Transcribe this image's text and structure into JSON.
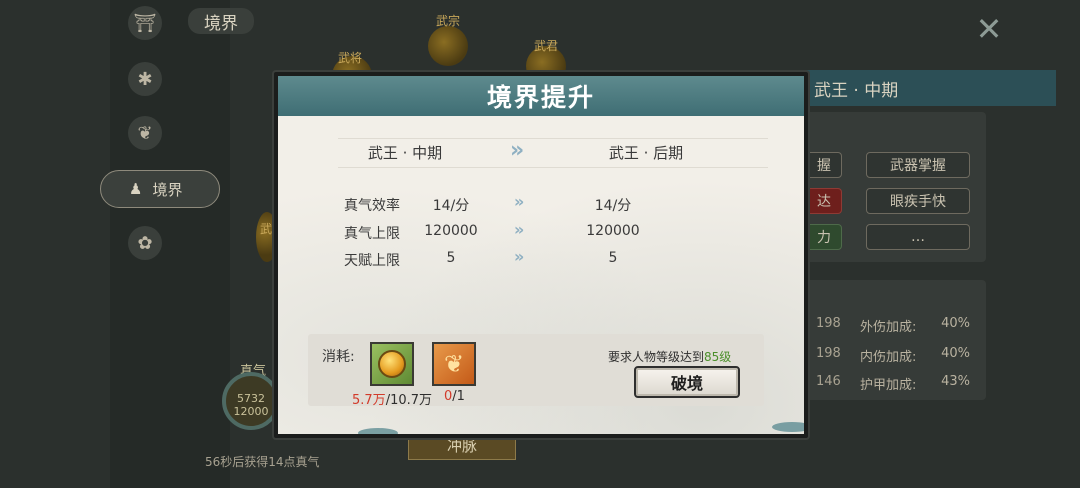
{
  "background": {
    "tab_title": "境界",
    "nav_items": [
      {
        "icon": "temple-icon",
        "glyph": "⛩"
      },
      {
        "icon": "beast-icon",
        "glyph": "✱"
      },
      {
        "icon": "flame-icon",
        "glyph": "❦"
      },
      {
        "icon": "gourd-icon",
        "glyph": "♟",
        "label": "境界",
        "active": true
      },
      {
        "icon": "creature-icon",
        "glyph": "✿"
      }
    ],
    "close_glyph": "✕",
    "right_header": "武王 · 中期",
    "right_tags": [
      "握",
      "武器掌握",
      "达",
      "眼疾手快",
      "力",
      "…"
    ],
    "right_stats": [
      {
        "num": "198",
        "label": "外伤加成:",
        "value": "40%"
      },
      {
        "num": "198",
        "label": "内伤加成:",
        "value": "40%"
      },
      {
        "num": "146",
        "label": "护甲加成:",
        "value": "43%"
      }
    ],
    "orbs": [
      {
        "label": "武将"
      },
      {
        "label": "武宗"
      },
      {
        "label": "武君"
      },
      {
        "label": "武"
      }
    ],
    "gauge_label": "真气",
    "gauge_value": "5732",
    "gauge_sub": "12000",
    "bottom_button": "冲脉",
    "footer_text": "56秒后获得14点真气"
  },
  "modal": {
    "title": "境界提升",
    "current_stage": "武王 · 中期",
    "next_stage": "武王 · 后期",
    "arrow_glyph": "»",
    "stats": [
      {
        "label": "真气效率",
        "from": "14/分",
        "to": "14/分"
      },
      {
        "label": "真气上限",
        "from": "120000",
        "to": "120000"
      },
      {
        "label": "天赋上限",
        "from": "5",
        "to": "5"
      }
    ],
    "cost_label": "消耗:",
    "items": [
      {
        "icon": "gold-orb-icon",
        "have": "5.7万",
        "need": "/10.7万"
      },
      {
        "icon": "golden-branch-icon",
        "have": "0",
        "need": "/1"
      }
    ],
    "requirement_prefix": "要求人物等级达到",
    "requirement_level": "85级",
    "break_button": "破境"
  }
}
